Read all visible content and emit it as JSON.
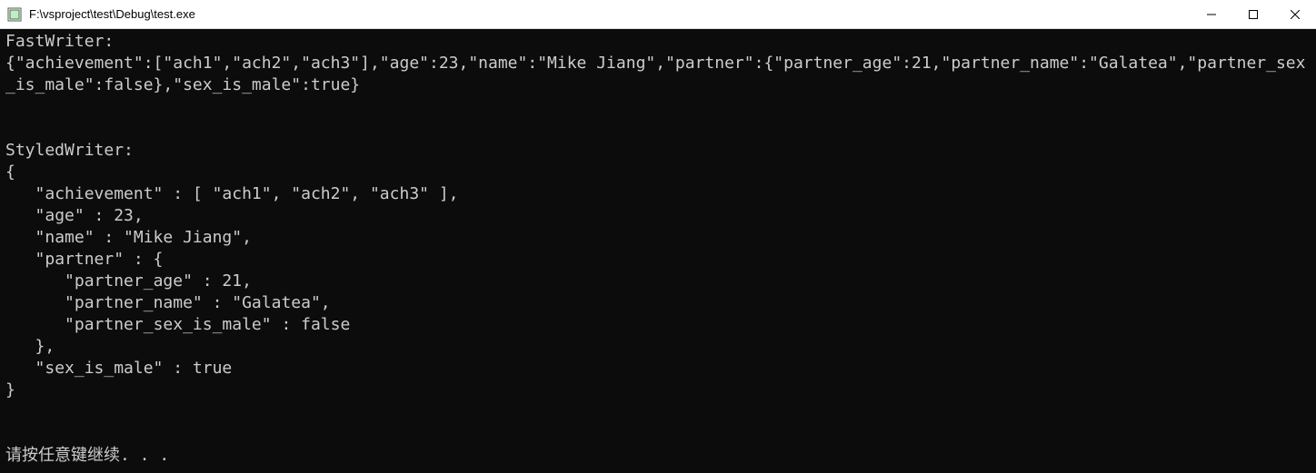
{
  "window": {
    "title": "F:\\vsproject\\test\\Debug\\test.exe"
  },
  "console": {
    "lines": {
      "l0": "FastWriter:",
      "l1": "{\"achievement\":[\"ach1\",\"ach2\",\"ach3\"],\"age\":23,\"name\":\"Mike Jiang\",\"partner\":{\"partner_age\":21,\"partner_name\":\"Galatea\",\"partner_sex_is_male\":false},\"sex_is_male\":true}",
      "l2": "",
      "l3": "",
      "l4": "StyledWriter:",
      "l5": "{",
      "l6": "   \"achievement\" : [ \"ach1\", \"ach2\", \"ach3\" ],",
      "l7": "   \"age\" : 23,",
      "l8": "   \"name\" : \"Mike Jiang\",",
      "l9": "   \"partner\" : {",
      "l10": "      \"partner_age\" : 21,",
      "l11": "      \"partner_name\" : \"Galatea\",",
      "l12": "      \"partner_sex_is_male\" : false",
      "l13": "   },",
      "l14": "   \"sex_is_male\" : true",
      "l15": "}",
      "l16": "",
      "l17": "",
      "l18": "请按任意键继续. . ."
    }
  }
}
